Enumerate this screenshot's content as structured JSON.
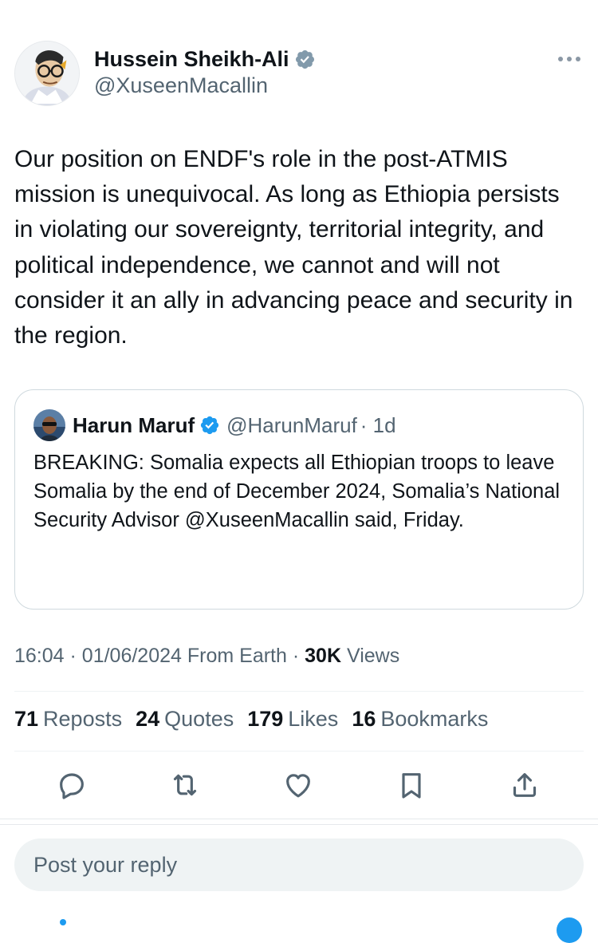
{
  "author": {
    "name": "Hussein Sheikh-Ali",
    "handle": "@XuseenMacallin"
  },
  "tweet": {
    "text": "Our position on ENDF's role in the post-ATMIS mission is unequivocal. As long as Ethiopia persists in violating our sovereignty, territorial integrity, and political independence, we cannot and will not consider it an ally in advancing peace and security in the region."
  },
  "quote": {
    "name": "Harun Maruf",
    "handle": "@HarunMaruf",
    "time": "· 1d",
    "text": "BREAKING: Somalia expects all Ethiopian troops to leave Somalia by the end of December 2024, Somalia’s National Security Advisor @XuseenMacallin said, Friday."
  },
  "meta": {
    "time": "16:04",
    "sep1": "·",
    "date": "01/06/2024",
    "source": "From Earth",
    "sep2": "·",
    "views_count": "30K",
    "views_label": "Views"
  },
  "stats": [
    {
      "count": "71",
      "label": "Reposts"
    },
    {
      "count": "24",
      "label": "Quotes"
    },
    {
      "count": "179",
      "label": "Likes"
    },
    {
      "count": "16",
      "label": "Bookmarks"
    }
  ],
  "reply": {
    "placeholder": "Post your reply"
  },
  "colors": {
    "accent": "#1d9bf0",
    "text": "#0f1419",
    "secondary": "#536471",
    "verified": "#829aab"
  },
  "icons": [
    "verified-badge-icon",
    "more-icon",
    "reply-icon",
    "repost-icon",
    "like-icon",
    "bookmark-icon",
    "share-icon"
  ]
}
